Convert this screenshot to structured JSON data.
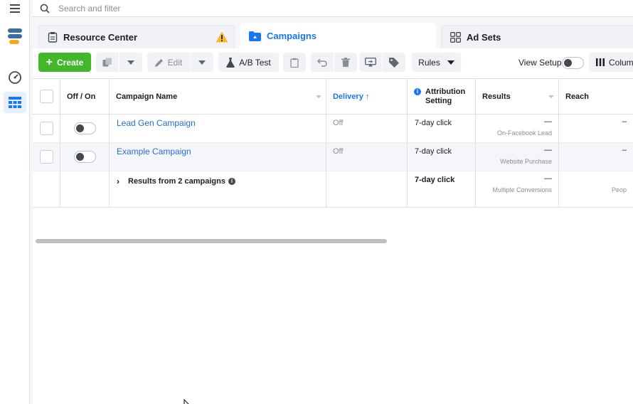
{
  "search": {
    "placeholder": "Search and filter"
  },
  "tabs": {
    "resource_center": "Resource Center",
    "campaigns": "Campaigns",
    "ad_sets": "Ad Sets"
  },
  "toolbar": {
    "create": "Create",
    "edit": "Edit",
    "ab_test": "A/B Test",
    "rules": "Rules",
    "view_setup": "View Setup",
    "columns": "Colum"
  },
  "table": {
    "headers": {
      "off_on": "Off / On",
      "campaign_name": "Campaign Name",
      "delivery": "Delivery ↑",
      "attribution_line1": "Attribution",
      "attribution_line2": "Setting",
      "results": "Results",
      "reach": "Reach"
    },
    "rows": [
      {
        "name": "Lead Gen Campaign",
        "delivery": "Off",
        "attribution": "7-day click",
        "results": "—",
        "results_sub": "On-Facebook Lead",
        "reach": "–"
      },
      {
        "name": "Example Campaign",
        "delivery": "Off",
        "attribution": "7-day click",
        "results": "—",
        "results_sub": "Website Purchase",
        "reach": "–"
      }
    ],
    "summary": {
      "label": "Results from 2 campaigns",
      "attribution": "7-day click",
      "results": "—",
      "results_sub": "Multiple Conversions",
      "reach_sub": "Peop"
    }
  },
  "colors": {
    "accent": "#1877f2",
    "create_green": "#42b72a",
    "link": "#216fdb"
  }
}
